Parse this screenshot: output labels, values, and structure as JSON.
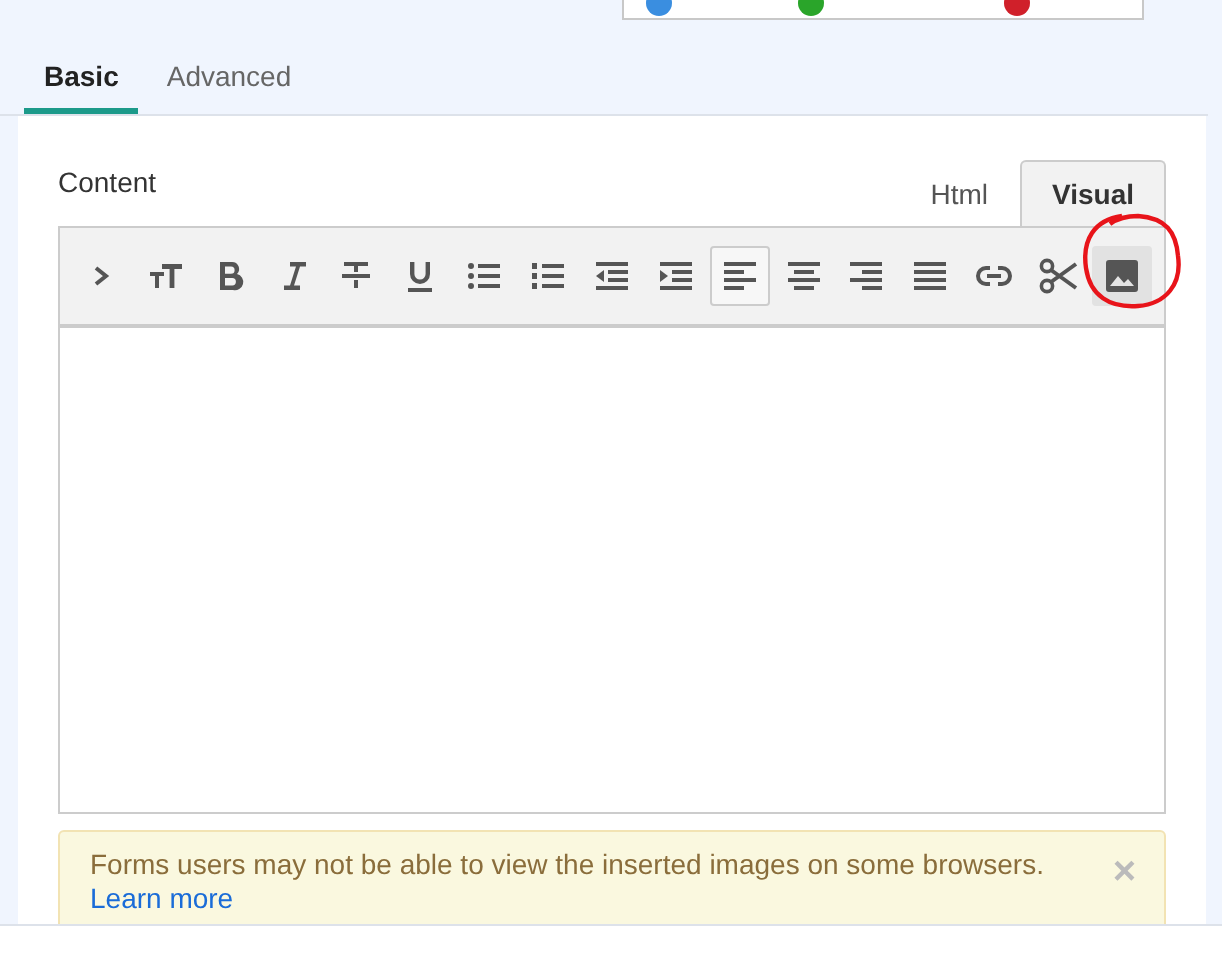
{
  "top_card": {
    "dots": [
      {
        "color": "#3a8ee0"
      },
      {
        "color": "#2aa52a"
      },
      {
        "color": "#d0202a"
      }
    ]
  },
  "tabs": [
    {
      "label": "Basic",
      "selected": true
    },
    {
      "label": "Advanced",
      "selected": false
    }
  ],
  "section_label": "Content",
  "editor_tabs": [
    {
      "label": "Html",
      "selected": false
    },
    {
      "label": "Visual",
      "selected": true
    }
  ],
  "toolbar": [
    {
      "kind": "chevron",
      "selected": false
    },
    {
      "kind": "text-size",
      "selected": false
    },
    {
      "kind": "bold",
      "selected": false
    },
    {
      "kind": "italic",
      "selected": false
    },
    {
      "kind": "strikethrough",
      "selected": false
    },
    {
      "kind": "underline",
      "selected": false
    },
    {
      "kind": "bullet-list",
      "selected": false
    },
    {
      "kind": "numbered-list",
      "selected": false
    },
    {
      "kind": "outdent",
      "selected": false
    },
    {
      "kind": "indent",
      "selected": false
    },
    {
      "kind": "align-left",
      "selected": true
    },
    {
      "kind": "align-center",
      "selected": false
    },
    {
      "kind": "align-right",
      "selected": false
    },
    {
      "kind": "justify",
      "selected": false
    },
    {
      "kind": "link",
      "selected": false
    },
    {
      "kind": "scissors",
      "selected": false
    },
    {
      "kind": "image",
      "selected": false,
      "highlighted": true
    }
  ],
  "alert": {
    "message": "Forms users may not be able to view the inserted images on some browsers.",
    "link": "Learn more",
    "close": "×"
  }
}
